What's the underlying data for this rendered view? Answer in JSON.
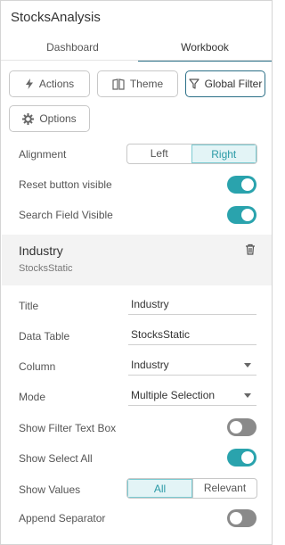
{
  "app": {
    "title": "StocksAnalysis"
  },
  "tabs": [
    {
      "label": "Dashboard"
    },
    {
      "label": "Workbook"
    }
  ],
  "toolbar": {
    "actions": "Actions",
    "theme": "Theme",
    "global_filter": "Global Filter",
    "options": "Options"
  },
  "settings": {
    "alignment": {
      "label": "Alignment",
      "options": [
        "Left",
        "Right"
      ],
      "selected": "Right"
    },
    "reset_button_visible": {
      "label": "Reset button visible",
      "on": true
    },
    "search_field_visible": {
      "label": "Search Field Visible",
      "on": true
    }
  },
  "filter": {
    "name": "Industry",
    "source": "StocksStatic",
    "title": {
      "label": "Title",
      "value": "Industry"
    },
    "data_table": {
      "label": "Data Table",
      "value": "StocksStatic"
    },
    "column": {
      "label": "Column",
      "value": "Industry"
    },
    "mode": {
      "label": "Mode",
      "value": "Multiple Selection"
    },
    "show_filter_text_box": {
      "label": "Show Filter Text Box",
      "on": false
    },
    "show_select_all": {
      "label": "Show Select All",
      "on": true
    },
    "show_values": {
      "label": "Show Values",
      "options": [
        "All",
        "Relevant"
      ],
      "selected": "All"
    },
    "append_separator": {
      "label": "Append Separator",
      "on": false
    }
  },
  "colors": {
    "accent": "#2aa3ad",
    "tab_underline": "#2b6f87",
    "toggle_off": "#8a8a8a"
  }
}
